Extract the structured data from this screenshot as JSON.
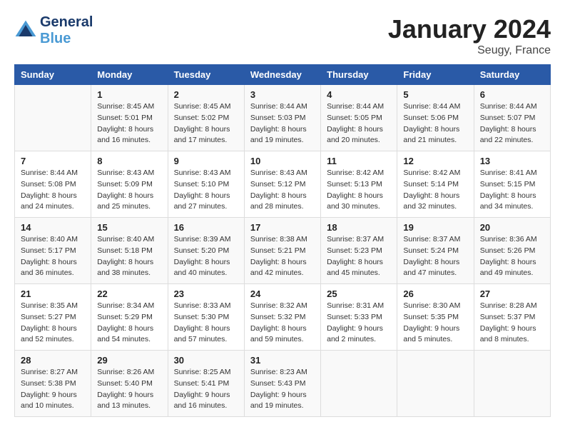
{
  "header": {
    "logo_line1": "General",
    "logo_line2": "Blue",
    "month": "January 2024",
    "location": "Seugy, France"
  },
  "columns": [
    "Sunday",
    "Monday",
    "Tuesday",
    "Wednesday",
    "Thursday",
    "Friday",
    "Saturday"
  ],
  "weeks": [
    [
      {
        "day": "",
        "sunrise": "",
        "sunset": "",
        "daylight": ""
      },
      {
        "day": "1",
        "sunrise": "Sunrise: 8:45 AM",
        "sunset": "Sunset: 5:01 PM",
        "daylight": "Daylight: 8 hours and 16 minutes."
      },
      {
        "day": "2",
        "sunrise": "Sunrise: 8:45 AM",
        "sunset": "Sunset: 5:02 PM",
        "daylight": "Daylight: 8 hours and 17 minutes."
      },
      {
        "day": "3",
        "sunrise": "Sunrise: 8:44 AM",
        "sunset": "Sunset: 5:03 PM",
        "daylight": "Daylight: 8 hours and 19 minutes."
      },
      {
        "day": "4",
        "sunrise": "Sunrise: 8:44 AM",
        "sunset": "Sunset: 5:05 PM",
        "daylight": "Daylight: 8 hours and 20 minutes."
      },
      {
        "day": "5",
        "sunrise": "Sunrise: 8:44 AM",
        "sunset": "Sunset: 5:06 PM",
        "daylight": "Daylight: 8 hours and 21 minutes."
      },
      {
        "day": "6",
        "sunrise": "Sunrise: 8:44 AM",
        "sunset": "Sunset: 5:07 PM",
        "daylight": "Daylight: 8 hours and 22 minutes."
      }
    ],
    [
      {
        "day": "7",
        "sunrise": "Sunrise: 8:44 AM",
        "sunset": "Sunset: 5:08 PM",
        "daylight": "Daylight: 8 hours and 24 minutes."
      },
      {
        "day": "8",
        "sunrise": "Sunrise: 8:43 AM",
        "sunset": "Sunset: 5:09 PM",
        "daylight": "Daylight: 8 hours and 25 minutes."
      },
      {
        "day": "9",
        "sunrise": "Sunrise: 8:43 AM",
        "sunset": "Sunset: 5:10 PM",
        "daylight": "Daylight: 8 hours and 27 minutes."
      },
      {
        "day": "10",
        "sunrise": "Sunrise: 8:43 AM",
        "sunset": "Sunset: 5:12 PM",
        "daylight": "Daylight: 8 hours and 28 minutes."
      },
      {
        "day": "11",
        "sunrise": "Sunrise: 8:42 AM",
        "sunset": "Sunset: 5:13 PM",
        "daylight": "Daylight: 8 hours and 30 minutes."
      },
      {
        "day": "12",
        "sunrise": "Sunrise: 8:42 AM",
        "sunset": "Sunset: 5:14 PM",
        "daylight": "Daylight: 8 hours and 32 minutes."
      },
      {
        "day": "13",
        "sunrise": "Sunrise: 8:41 AM",
        "sunset": "Sunset: 5:15 PM",
        "daylight": "Daylight: 8 hours and 34 minutes."
      }
    ],
    [
      {
        "day": "14",
        "sunrise": "Sunrise: 8:40 AM",
        "sunset": "Sunset: 5:17 PM",
        "daylight": "Daylight: 8 hours and 36 minutes."
      },
      {
        "day": "15",
        "sunrise": "Sunrise: 8:40 AM",
        "sunset": "Sunset: 5:18 PM",
        "daylight": "Daylight: 8 hours and 38 minutes."
      },
      {
        "day": "16",
        "sunrise": "Sunrise: 8:39 AM",
        "sunset": "Sunset: 5:20 PM",
        "daylight": "Daylight: 8 hours and 40 minutes."
      },
      {
        "day": "17",
        "sunrise": "Sunrise: 8:38 AM",
        "sunset": "Sunset: 5:21 PM",
        "daylight": "Daylight: 8 hours and 42 minutes."
      },
      {
        "day": "18",
        "sunrise": "Sunrise: 8:37 AM",
        "sunset": "Sunset: 5:23 PM",
        "daylight": "Daylight: 8 hours and 45 minutes."
      },
      {
        "day": "19",
        "sunrise": "Sunrise: 8:37 AM",
        "sunset": "Sunset: 5:24 PM",
        "daylight": "Daylight: 8 hours and 47 minutes."
      },
      {
        "day": "20",
        "sunrise": "Sunrise: 8:36 AM",
        "sunset": "Sunset: 5:26 PM",
        "daylight": "Daylight: 8 hours and 49 minutes."
      }
    ],
    [
      {
        "day": "21",
        "sunrise": "Sunrise: 8:35 AM",
        "sunset": "Sunset: 5:27 PM",
        "daylight": "Daylight: 8 hours and 52 minutes."
      },
      {
        "day": "22",
        "sunrise": "Sunrise: 8:34 AM",
        "sunset": "Sunset: 5:29 PM",
        "daylight": "Daylight: 8 hours and 54 minutes."
      },
      {
        "day": "23",
        "sunrise": "Sunrise: 8:33 AM",
        "sunset": "Sunset: 5:30 PM",
        "daylight": "Daylight: 8 hours and 57 minutes."
      },
      {
        "day": "24",
        "sunrise": "Sunrise: 8:32 AM",
        "sunset": "Sunset: 5:32 PM",
        "daylight": "Daylight: 8 hours and 59 minutes."
      },
      {
        "day": "25",
        "sunrise": "Sunrise: 8:31 AM",
        "sunset": "Sunset: 5:33 PM",
        "daylight": "Daylight: 9 hours and 2 minutes."
      },
      {
        "day": "26",
        "sunrise": "Sunrise: 8:30 AM",
        "sunset": "Sunset: 5:35 PM",
        "daylight": "Daylight: 9 hours and 5 minutes."
      },
      {
        "day": "27",
        "sunrise": "Sunrise: 8:28 AM",
        "sunset": "Sunset: 5:37 PM",
        "daylight": "Daylight: 9 hours and 8 minutes."
      }
    ],
    [
      {
        "day": "28",
        "sunrise": "Sunrise: 8:27 AM",
        "sunset": "Sunset: 5:38 PM",
        "daylight": "Daylight: 9 hours and 10 minutes."
      },
      {
        "day": "29",
        "sunrise": "Sunrise: 8:26 AM",
        "sunset": "Sunset: 5:40 PM",
        "daylight": "Daylight: 9 hours and 13 minutes."
      },
      {
        "day": "30",
        "sunrise": "Sunrise: 8:25 AM",
        "sunset": "Sunset: 5:41 PM",
        "daylight": "Daylight: 9 hours and 16 minutes."
      },
      {
        "day": "31",
        "sunrise": "Sunrise: 8:23 AM",
        "sunset": "Sunset: 5:43 PM",
        "daylight": "Daylight: 9 hours and 19 minutes."
      },
      {
        "day": "",
        "sunrise": "",
        "sunset": "",
        "daylight": ""
      },
      {
        "day": "",
        "sunrise": "",
        "sunset": "",
        "daylight": ""
      },
      {
        "day": "",
        "sunrise": "",
        "sunset": "",
        "daylight": ""
      }
    ]
  ]
}
